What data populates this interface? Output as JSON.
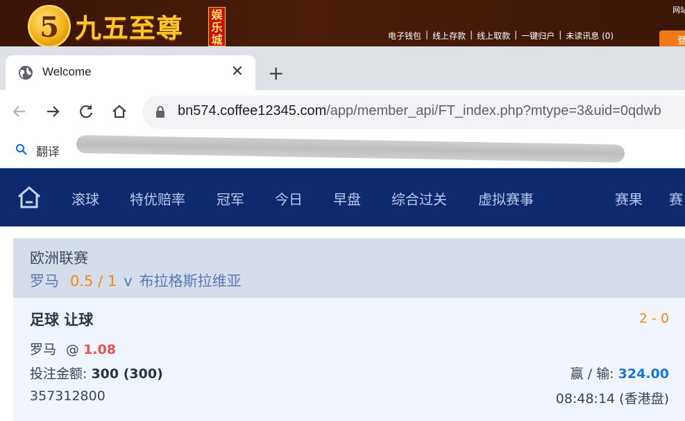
{
  "site_header": {
    "logo_mark": "5",
    "logo_text": "九五至尊",
    "logo_tag": "娱乐城",
    "links": [
      "电子钱包",
      "线上存款",
      "线上取款",
      "一键归户",
      "未读讯息 (0)"
    ],
    "top_right_text": "网站",
    "login_button": "登"
  },
  "browser": {
    "tab_title": "Welcome",
    "url_host": "bn574.coffee12345.com",
    "url_path": "/app/member_api/FT_index.php?mtype=3&uid=0qdwb",
    "bookmark_label": "翻译"
  },
  "nav": {
    "items": [
      "滚球",
      "特优赔率",
      "冠军",
      "今日",
      "早盘",
      "综合过关",
      "虚拟赛事",
      "赛果",
      "赛"
    ]
  },
  "bet": {
    "league": "欧洲联赛",
    "home_team": "罗马",
    "handicap": "0.5 / 1",
    "vs": "v",
    "away_team": "布拉格斯拉维亚",
    "bet_type": "足球 让球",
    "score": "2 - 0",
    "pick_team": "罗马",
    "at": "@",
    "odds": "1.08",
    "stake_label": "投注金额:",
    "stake_value": "300 (300)",
    "winloss_label": "赢 / 输:",
    "winloss_value": "324.00",
    "ticket_id": "357312800",
    "time": "08:48:14 (香港盘)"
  },
  "colors": {
    "banner": "#3a1407",
    "nav_bg": "#0d2a6f",
    "accent_orange": "#ef8a14",
    "odds_red": "#e5534b",
    "amount_blue": "#1976d2"
  }
}
